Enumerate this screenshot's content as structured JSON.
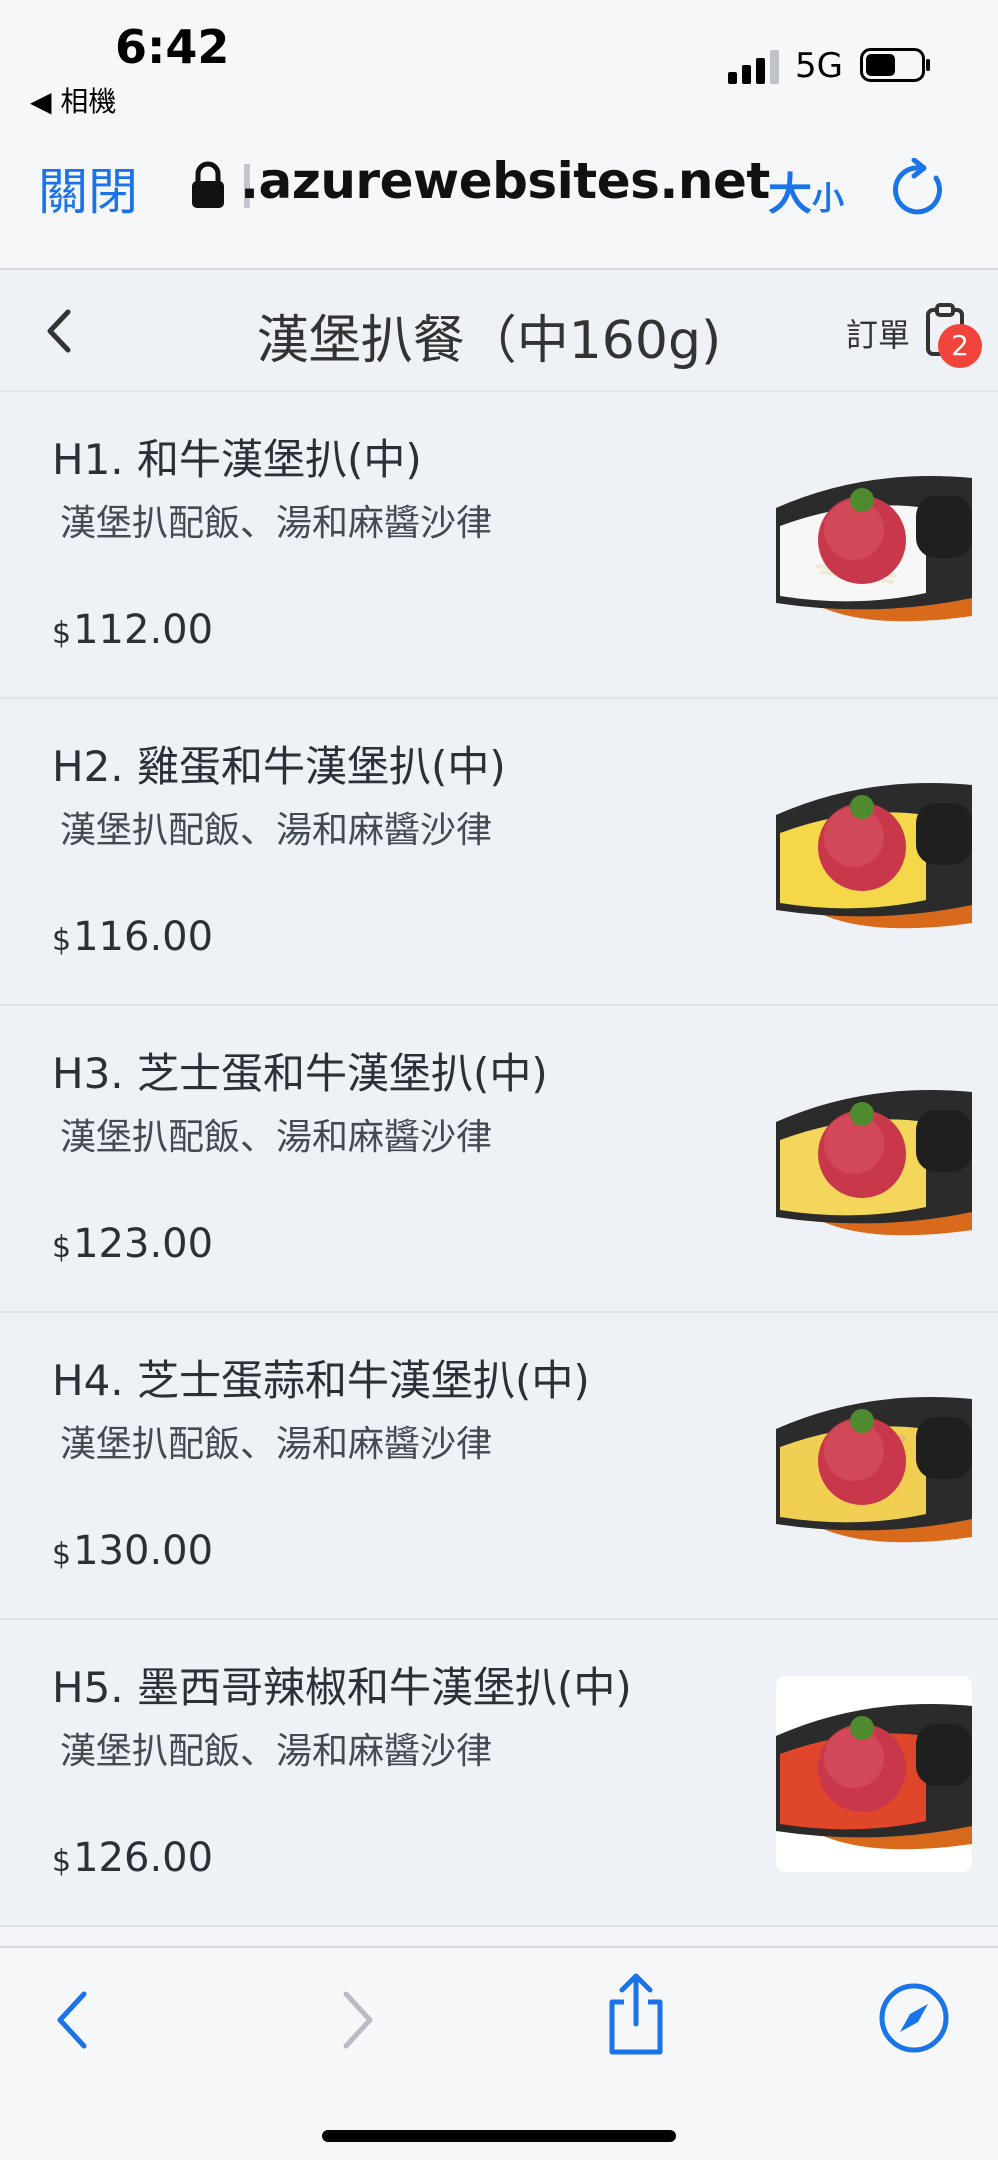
{
  "status_bar": {
    "time": "6:42",
    "back_app": "◀ 相機",
    "network": "5G",
    "battery_level": 0.55
  },
  "browser": {
    "close_label": "關閉",
    "url": ".azurewebsites.net",
    "text_size_big": "大",
    "text_size_small": "小"
  },
  "header": {
    "title": "漢堡扒餐（中160g)",
    "orders_label": "訂單",
    "order_count": "2"
  },
  "currency_symbol": "$",
  "menu_items": [
    {
      "name": "H1. 和牛漢堡扒(中)",
      "description": "漢堡扒配飯、湯和麻醬沙律",
      "price": "112.00",
      "topping": "plain"
    },
    {
      "name": "H2. 雞蛋和牛漢堡扒(中)",
      "description": "漢堡扒配飯、湯和麻醬沙律",
      "price": "116.00",
      "topping": "egg"
    },
    {
      "name": "H3. 芝士蛋和牛漢堡扒(中)",
      "description": "漢堡扒配飯、湯和麻醬沙律",
      "price": "123.00",
      "topping": "cheese"
    },
    {
      "name": "H4. 芝士蛋蒜和牛漢堡扒(中)",
      "description": "漢堡扒配飯、湯和麻醬沙律",
      "price": "130.00",
      "topping": "garlic"
    },
    {
      "name": "H5. 墨西哥辣椒和牛漢堡扒(中)",
      "description": "漢堡扒配飯、湯和麻醬沙律",
      "price": "126.00",
      "topping": "chili"
    }
  ],
  "colors": {
    "accent": "#1a73e8",
    "badge": "#f1443b",
    "background": "#eef1f5"
  }
}
